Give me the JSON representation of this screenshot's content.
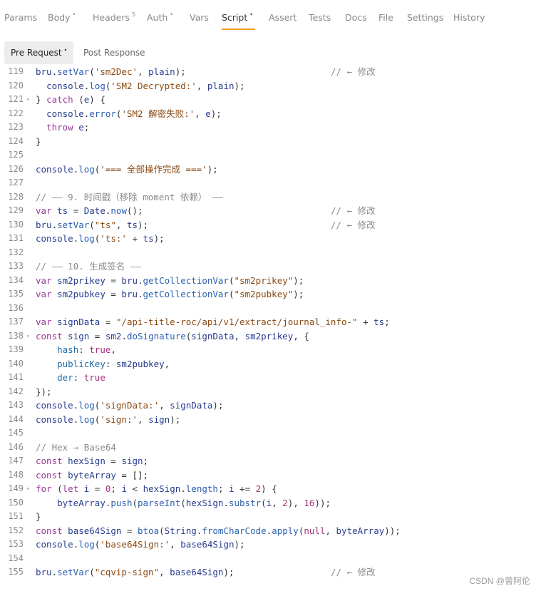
{
  "tabs": [
    {
      "label": "Params",
      "sup": ""
    },
    {
      "label": "Body",
      "sup": "•"
    },
    {
      "label": "Headers",
      "sup": "5"
    },
    {
      "label": "Auth",
      "sup": "•"
    },
    {
      "label": "Vars",
      "sup": ""
    },
    {
      "label": "Script",
      "sup": "•"
    },
    {
      "label": "Assert",
      "sup": ""
    },
    {
      "label": "Tests",
      "sup": ""
    },
    {
      "label": "Docs",
      "sup": ""
    },
    {
      "label": "File",
      "sup": ""
    },
    {
      "label": "Settings",
      "sup": ""
    },
    {
      "label": "History",
      "sup": ""
    }
  ],
  "active_tab": "Script",
  "accent_color": "#f39c12",
  "subtabs": [
    {
      "label": "Pre Request",
      "sup": "•"
    },
    {
      "label": "Post Response",
      "sup": ""
    }
  ],
  "active_subtab": "Pre Request",
  "editor": {
    "lines": [
      {
        "n": "119",
        "fold": false,
        "code": [
          [
            "v",
            "bru"
          ],
          [
            "t",
            "."
          ],
          [
            "f",
            "setVar"
          ],
          [
            "t",
            "("
          ],
          [
            "s",
            "'sm2Dec'"
          ],
          [
            "t",
            ", "
          ],
          [
            "v",
            "plain"
          ],
          [
            "t",
            ");"
          ]
        ],
        "comment": "// ← 修改"
      },
      {
        "n": "120",
        "fold": false,
        "code": [
          [
            "t",
            "  "
          ],
          [
            "v",
            "console"
          ],
          [
            "t",
            "."
          ],
          [
            "f",
            "log"
          ],
          [
            "t",
            "("
          ],
          [
            "s",
            "'SM2 Decrypted:'"
          ],
          [
            "t",
            ", "
          ],
          [
            "v",
            "plain"
          ],
          [
            "t",
            ");"
          ]
        ],
        "comment": ""
      },
      {
        "n": "121",
        "fold": true,
        "code": [
          [
            "t",
            "} "
          ],
          [
            "k",
            "catch"
          ],
          [
            "t",
            " ("
          ],
          [
            "v",
            "e"
          ],
          [
            "t",
            ") {"
          ]
        ],
        "comment": ""
      },
      {
        "n": "122",
        "fold": false,
        "code": [
          [
            "t",
            "  "
          ],
          [
            "v",
            "console"
          ],
          [
            "t",
            "."
          ],
          [
            "f",
            "error"
          ],
          [
            "t",
            "("
          ],
          [
            "s",
            "'SM2 解密失败:'"
          ],
          [
            "t",
            ", "
          ],
          [
            "v",
            "e"
          ],
          [
            "t",
            ");"
          ]
        ],
        "comment": ""
      },
      {
        "n": "123",
        "fold": false,
        "code": [
          [
            "t",
            "  "
          ],
          [
            "k",
            "throw"
          ],
          [
            "t",
            " "
          ],
          [
            "v",
            "e"
          ],
          [
            "t",
            ";"
          ]
        ],
        "comment": ""
      },
      {
        "n": "124",
        "fold": false,
        "code": [
          [
            "t",
            "}"
          ]
        ],
        "comment": ""
      },
      {
        "n": "125",
        "fold": false,
        "code": [],
        "comment": ""
      },
      {
        "n": "126",
        "fold": false,
        "code": [
          [
            "v",
            "console"
          ],
          [
            "t",
            "."
          ],
          [
            "f",
            "log"
          ],
          [
            "t",
            "("
          ],
          [
            "s",
            "'=== 全部操作完成 ==='"
          ],
          [
            "t",
            ");"
          ]
        ],
        "comment": ""
      },
      {
        "n": "127",
        "fold": false,
        "code": [],
        "comment": ""
      },
      {
        "n": "128",
        "fold": false,
        "code": [
          [
            "c",
            "// —— 9. 时间戳（移除 moment 依赖） ——"
          ]
        ],
        "comment": ""
      },
      {
        "n": "129",
        "fold": false,
        "code": [
          [
            "k",
            "var"
          ],
          [
            "t",
            " "
          ],
          [
            "v",
            "ts"
          ],
          [
            "t",
            " = "
          ],
          [
            "v",
            "Date"
          ],
          [
            "t",
            "."
          ],
          [
            "f",
            "now"
          ],
          [
            "t",
            "();"
          ]
        ],
        "comment": "// ← 修改"
      },
      {
        "n": "130",
        "fold": false,
        "code": [
          [
            "v",
            "bru"
          ],
          [
            "t",
            "."
          ],
          [
            "f",
            "setVar"
          ],
          [
            "t",
            "("
          ],
          [
            "s",
            "\"ts\""
          ],
          [
            "t",
            ", "
          ],
          [
            "v",
            "ts"
          ],
          [
            "t",
            ");"
          ]
        ],
        "comment": "// ← 修改"
      },
      {
        "n": "131",
        "fold": false,
        "code": [
          [
            "v",
            "console"
          ],
          [
            "t",
            "."
          ],
          [
            "f",
            "log"
          ],
          [
            "t",
            "("
          ],
          [
            "s",
            "'ts:'"
          ],
          [
            "t",
            " + "
          ],
          [
            "v",
            "ts"
          ],
          [
            "t",
            ");"
          ]
        ],
        "comment": ""
      },
      {
        "n": "132",
        "fold": false,
        "code": [],
        "comment": ""
      },
      {
        "n": "133",
        "fold": false,
        "code": [
          [
            "c",
            "// —— 10. 生成签名 ——"
          ]
        ],
        "comment": ""
      },
      {
        "n": "134",
        "fold": false,
        "code": [
          [
            "k",
            "var"
          ],
          [
            "t",
            " "
          ],
          [
            "v",
            "sm2prikey"
          ],
          [
            "t",
            " = "
          ],
          [
            "v",
            "bru"
          ],
          [
            "t",
            "."
          ],
          [
            "f",
            "getCollectionVar"
          ],
          [
            "t",
            "("
          ],
          [
            "s",
            "\"sm2prikey\""
          ],
          [
            "t",
            ");"
          ]
        ],
        "comment": ""
      },
      {
        "n": "135",
        "fold": false,
        "code": [
          [
            "k",
            "var"
          ],
          [
            "t",
            " "
          ],
          [
            "v",
            "sm2pubkey"
          ],
          [
            "t",
            " = "
          ],
          [
            "v",
            "bru"
          ],
          [
            "t",
            "."
          ],
          [
            "f",
            "getCollectionVar"
          ],
          [
            "t",
            "("
          ],
          [
            "s",
            "\"sm2pubkey\""
          ],
          [
            "t",
            ");"
          ]
        ],
        "comment": ""
      },
      {
        "n": "136",
        "fold": false,
        "code": [],
        "comment": ""
      },
      {
        "n": "137",
        "fold": false,
        "code": [
          [
            "k",
            "var"
          ],
          [
            "t",
            " "
          ],
          [
            "v",
            "signData"
          ],
          [
            "t",
            " = "
          ],
          [
            "s",
            "\"/api-title-roc/api/v1/extract/journal_info-\""
          ],
          [
            "t",
            " + "
          ],
          [
            "v",
            "ts"
          ],
          [
            "t",
            ";"
          ]
        ],
        "comment": ""
      },
      {
        "n": "138",
        "fold": true,
        "code": [
          [
            "k",
            "const"
          ],
          [
            "t",
            " "
          ],
          [
            "v",
            "sign"
          ],
          [
            "t",
            " = "
          ],
          [
            "v",
            "sm2"
          ],
          [
            "t",
            "."
          ],
          [
            "f",
            "doSignature"
          ],
          [
            "t",
            "("
          ],
          [
            "v",
            "signData"
          ],
          [
            "t",
            ", "
          ],
          [
            "v",
            "sm2prikey"
          ],
          [
            "t",
            ", {"
          ]
        ],
        "comment": ""
      },
      {
        "n": "139",
        "fold": false,
        "code": [
          [
            "t",
            "    "
          ],
          [
            "p",
            "hash"
          ],
          [
            "t",
            ": "
          ],
          [
            "n",
            "true"
          ],
          [
            "t",
            ","
          ]
        ],
        "comment": ""
      },
      {
        "n": "140",
        "fold": false,
        "code": [
          [
            "t",
            "    "
          ],
          [
            "p",
            "publicKey"
          ],
          [
            "t",
            ": "
          ],
          [
            "v",
            "sm2pubkey"
          ],
          [
            "t",
            ","
          ]
        ],
        "comment": ""
      },
      {
        "n": "141",
        "fold": false,
        "code": [
          [
            "t",
            "    "
          ],
          [
            "p",
            "der"
          ],
          [
            "t",
            ": "
          ],
          [
            "n",
            "true"
          ]
        ],
        "comment": ""
      },
      {
        "n": "142",
        "fold": false,
        "code": [
          [
            "t",
            "});"
          ]
        ],
        "comment": ""
      },
      {
        "n": "143",
        "fold": false,
        "code": [
          [
            "v",
            "console"
          ],
          [
            "t",
            "."
          ],
          [
            "f",
            "log"
          ],
          [
            "t",
            "("
          ],
          [
            "s",
            "'signData:'"
          ],
          [
            "t",
            ", "
          ],
          [
            "v",
            "signData"
          ],
          [
            "t",
            ");"
          ]
        ],
        "comment": ""
      },
      {
        "n": "144",
        "fold": false,
        "code": [
          [
            "v",
            "console"
          ],
          [
            "t",
            "."
          ],
          [
            "f",
            "log"
          ],
          [
            "t",
            "("
          ],
          [
            "s",
            "'sign:'"
          ],
          [
            "t",
            ", "
          ],
          [
            "v",
            "sign"
          ],
          [
            "t",
            ");"
          ]
        ],
        "comment": ""
      },
      {
        "n": "145",
        "fold": false,
        "code": [],
        "comment": ""
      },
      {
        "n": "146",
        "fold": false,
        "code": [
          [
            "c",
            "// Hex → Base64"
          ]
        ],
        "comment": ""
      },
      {
        "n": "147",
        "fold": false,
        "code": [
          [
            "k",
            "const"
          ],
          [
            "t",
            " "
          ],
          [
            "v",
            "hexSign"
          ],
          [
            "t",
            " = "
          ],
          [
            "v",
            "sign"
          ],
          [
            "t",
            ";"
          ]
        ],
        "comment": ""
      },
      {
        "n": "148",
        "fold": false,
        "code": [
          [
            "k",
            "const"
          ],
          [
            "t",
            " "
          ],
          [
            "v",
            "byteArray"
          ],
          [
            "t",
            " = [];"
          ]
        ],
        "comment": ""
      },
      {
        "n": "149",
        "fold": true,
        "code": [
          [
            "k",
            "for"
          ],
          [
            "t",
            " ("
          ],
          [
            "k",
            "let"
          ],
          [
            "t",
            " "
          ],
          [
            "v",
            "i"
          ],
          [
            "t",
            " = "
          ],
          [
            "n",
            "0"
          ],
          [
            "t",
            "; "
          ],
          [
            "v",
            "i"
          ],
          [
            "t",
            " < "
          ],
          [
            "v",
            "hexSign"
          ],
          [
            "t",
            "."
          ],
          [
            "f",
            "length"
          ],
          [
            "t",
            "; "
          ],
          [
            "v",
            "i"
          ],
          [
            "t",
            " += "
          ],
          [
            "n",
            "2"
          ],
          [
            "t",
            ") {"
          ]
        ],
        "comment": ""
      },
      {
        "n": "150",
        "fold": false,
        "code": [
          [
            "t",
            "    "
          ],
          [
            "v",
            "byteArray"
          ],
          [
            "t",
            "."
          ],
          [
            "f",
            "push"
          ],
          [
            "t",
            "("
          ],
          [
            "f",
            "parseInt"
          ],
          [
            "t",
            "("
          ],
          [
            "v",
            "hexSign"
          ],
          [
            "t",
            "."
          ],
          [
            "f",
            "substr"
          ],
          [
            "t",
            "("
          ],
          [
            "v",
            "i"
          ],
          [
            "t",
            ", "
          ],
          [
            "n",
            "2"
          ],
          [
            "t",
            "), "
          ],
          [
            "n",
            "16"
          ],
          [
            "t",
            "));"
          ]
        ],
        "comment": ""
      },
      {
        "n": "151",
        "fold": false,
        "code": [
          [
            "t",
            "}"
          ]
        ],
        "comment": ""
      },
      {
        "n": "152",
        "fold": false,
        "code": [
          [
            "k",
            "const"
          ],
          [
            "t",
            " "
          ],
          [
            "v",
            "base64Sign"
          ],
          [
            "t",
            " = "
          ],
          [
            "f",
            "btoa"
          ],
          [
            "t",
            "("
          ],
          [
            "v",
            "String"
          ],
          [
            "t",
            "."
          ],
          [
            "f",
            "fromCharCode"
          ],
          [
            "t",
            "."
          ],
          [
            "f",
            "apply"
          ],
          [
            "t",
            "("
          ],
          [
            "n",
            "null"
          ],
          [
            "t",
            ", "
          ],
          [
            "v",
            "byteArray"
          ],
          [
            "t",
            "));"
          ]
        ],
        "comment": ""
      },
      {
        "n": "153",
        "fold": false,
        "code": [
          [
            "v",
            "console"
          ],
          [
            "t",
            "."
          ],
          [
            "f",
            "log"
          ],
          [
            "t",
            "("
          ],
          [
            "s",
            "'base64Sign:'"
          ],
          [
            "t",
            ", "
          ],
          [
            "v",
            "base64Sign"
          ],
          [
            "t",
            ");"
          ]
        ],
        "comment": ""
      },
      {
        "n": "154",
        "fold": false,
        "code": [],
        "comment": ""
      },
      {
        "n": "155",
        "fold": false,
        "code": [
          [
            "v",
            "bru"
          ],
          [
            "t",
            "."
          ],
          [
            "f",
            "setVar"
          ],
          [
            "t",
            "("
          ],
          [
            "s",
            "\"cqvip-sign\""
          ],
          [
            "t",
            ", "
          ],
          [
            "v",
            "base64Sign"
          ],
          [
            "t",
            ");"
          ]
        ],
        "comment": "// ← 修改"
      }
    ]
  },
  "watermark": "CSDN @曾阿伦"
}
